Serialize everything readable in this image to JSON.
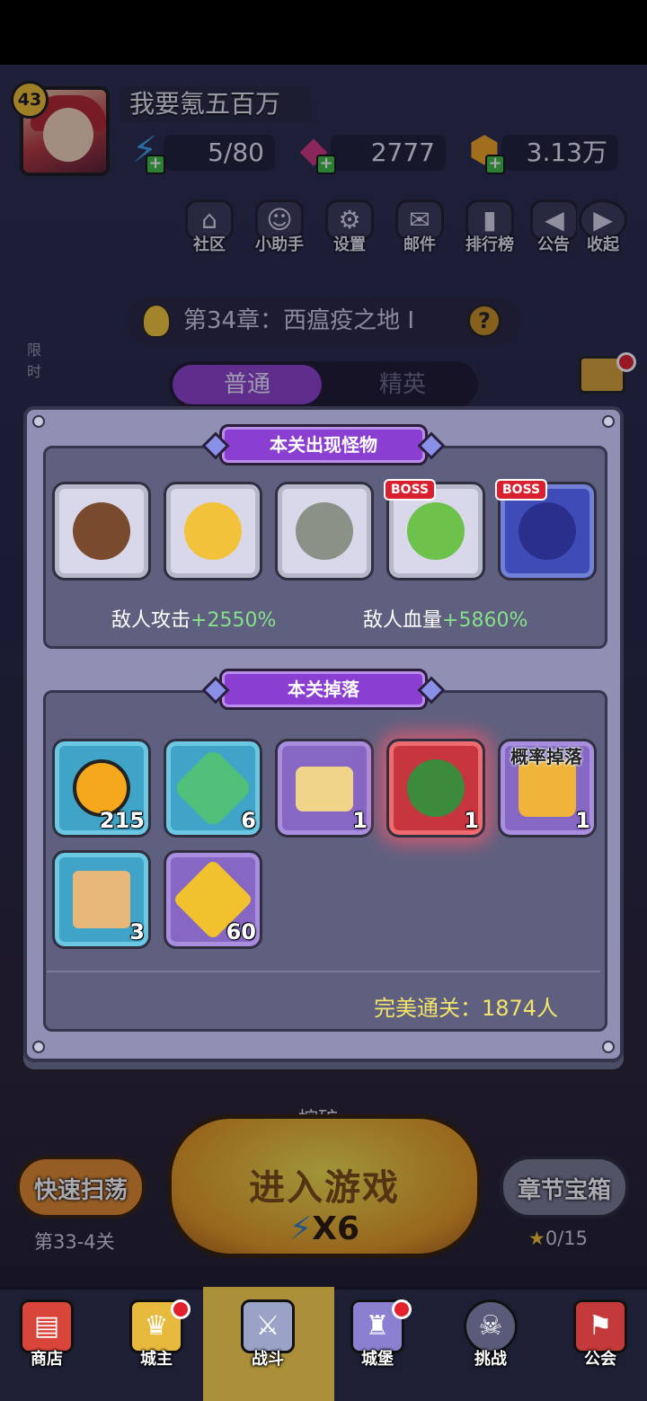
{
  "player": {
    "level": "43",
    "name": "我要氪五百万"
  },
  "resources": {
    "energy": "5/80",
    "gems": "2777",
    "gold": "3.13万"
  },
  "top_icons": [
    {
      "label": "社区",
      "icon": "home-star-icon"
    },
    {
      "label": "小助手",
      "icon": "robot-icon"
    },
    {
      "label": "设置",
      "icon": "gear-icon"
    },
    {
      "label": "邮件",
      "icon": "mail-icon"
    },
    {
      "label": "排行榜",
      "icon": "bar-chart-icon"
    },
    {
      "label": "公告",
      "icon": "megaphone-icon"
    },
    {
      "label": "收起",
      "icon": "play-icon"
    }
  ],
  "chapter": {
    "title": "第34章：西瘟疫之地 I"
  },
  "tabs": {
    "normal": "普通",
    "elite": "精英"
  },
  "side": {
    "limited": "限时",
    "gift": "礼包"
  },
  "monsters_panel": {
    "title": "本关出现怪物",
    "monsters": [
      {
        "icon": "boar-icon",
        "boss": false
      },
      {
        "icon": "fire-spirit-icon",
        "boss": false
      },
      {
        "icon": "rock-golem-icon",
        "boss": false
      },
      {
        "icon": "green-slime-icon",
        "boss": true
      },
      {
        "icon": "horned-demon-icon",
        "boss": true
      }
    ],
    "boss_label": "BOSS",
    "attack_label": "敌人攻击",
    "attack_value": "+2550%",
    "hp_label": "敌人血量",
    "hp_value": "+5860%"
  },
  "drops_panel": {
    "title": "本关掉落",
    "items": [
      {
        "icon": "gold-coin-icon",
        "count": "215",
        "style": "blue"
      },
      {
        "icon": "exp-icon",
        "count": "6",
        "style": "blue"
      },
      {
        "icon": "ticket-icon",
        "count": "1",
        "style": "purple"
      },
      {
        "icon": "mystery-gem-bag-icon",
        "count": "1",
        "style": "red"
      },
      {
        "icon": "fire-crystal-icon",
        "count": "1",
        "style": "purple"
      },
      {
        "icon": "mystery-scroll-icon",
        "count": "3",
        "style": "blue"
      },
      {
        "icon": "mystery-puzzle-icon",
        "count": "60",
        "style": "purple"
      }
    ],
    "probability_label": "概率掉落",
    "perfect_clear": "完美通关：1874人"
  },
  "lower": {
    "mine": "挖矿",
    "quick_sweep": "快速扫荡",
    "stage": "第33-4关",
    "enter_game": "进入游戏",
    "energy_cost": "X6",
    "chapter_chest": "章节宝箱",
    "stars": "0/15"
  },
  "nav": [
    {
      "label": "商店",
      "icon": "shop-icon",
      "color": "#d9443b"
    },
    {
      "label": "城主",
      "icon": "crown-icon",
      "color": "#e7b93c"
    },
    {
      "label": "战斗",
      "icon": "crossed-swords-icon",
      "color": "#9aa2c8"
    },
    {
      "label": "城堡",
      "icon": "castle-icon",
      "color": "#8a7fd0"
    },
    {
      "label": "挑战",
      "icon": "demon-mask-icon",
      "color": "#5a5a7a"
    },
    {
      "label": "公会",
      "icon": "guild-banner-icon",
      "color": "#c43a3a"
    }
  ],
  "colors": {
    "accent": "#8a3fd2",
    "positive": "#86e08a",
    "gold_text": "#f2e36a"
  }
}
